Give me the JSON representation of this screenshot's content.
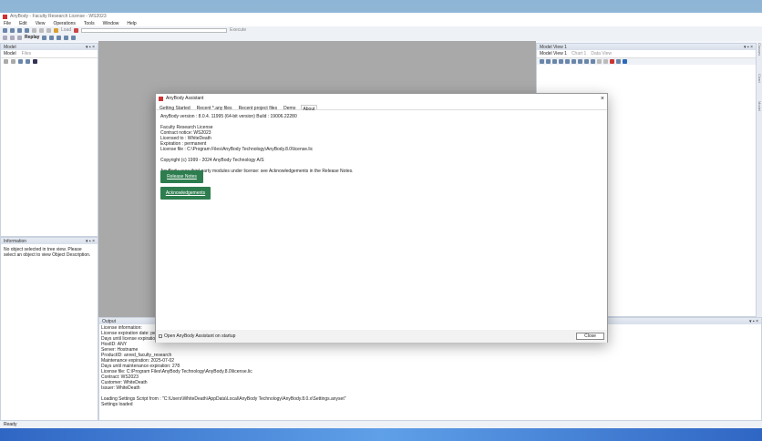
{
  "window": {
    "title": "AnyBody - Faculty Research License - WS2023"
  },
  "menu": [
    "File",
    "Edit",
    "View",
    "Operations",
    "Tools",
    "Window",
    "Help"
  ],
  "toolbar": {
    "load": "Load",
    "execute": "Execute",
    "replay": "Replay"
  },
  "model_panel": {
    "title": "Model",
    "tabs": [
      "Model",
      "Files"
    ]
  },
  "info_panel": {
    "title": "Information",
    "text": "No object selected in tree view. Please select an object to view Object Description."
  },
  "model_view": {
    "title": "Model View 1",
    "tabs": [
      "Model View 1",
      "Chart 1",
      "Data View"
    ]
  },
  "side_strip": [
    "Classes",
    "Chart",
    "Model"
  ],
  "output": {
    "title": "Output",
    "lines": [
      "License information:",
      "  License expiration date: permanent",
      "  Days until license expiration: 0",
      "  HostID: ANY",
      "  Server: Hostname",
      "  ProductID: anred_faculty_research",
      "  Maintenance expiration: 2025-07-02",
      "  Days until maintenance expiration: 278",
      "  License file: C:\\Program Files\\AnyBody Technology\\AnyBody.8.0\\license.lic",
      "  Contract: WS2023",
      "  Customer: WhiteDeath",
      "  Issuer: WhiteDeath",
      "",
      "Loading Settings Script from : \"C:\\Users\\WhiteDeath\\AppData\\Local\\AnyBody Technology\\AnyBody.8.0.x\\Settings.anyset\"",
      "Settings loaded"
    ]
  },
  "status": "Ready",
  "dialog": {
    "title": "AnyBody Assistant",
    "tabs": [
      "Getting Started",
      "Recent *.any files",
      "Recent project files",
      "Demo",
      "About"
    ],
    "active_tab": 4,
    "lines": [
      "AnyBody version : 8.0.4. 11995 (64-bit version) Build : 19006.22280",
      "",
      "Faculty Research License",
      "Contract notice: WS2023",
      "Licensed to : WhiteDeath",
      "Expiration : permanent",
      "License file : C:\\Program Files\\AnyBody Technology\\AnyBody.8.0\\license.lic",
      "",
      "Copyright (c) 1999 - 2024 AnyBody Technology A/S",
      "",
      "AnyBody uses third party modules under license: see Acknowledgements in the Release Notes."
    ],
    "release_notes": "Release Notes",
    "acknowledgements": "Acknowledgements",
    "startup_checkbox": "Open AnyBody Assistant on startup",
    "close": "Close"
  }
}
